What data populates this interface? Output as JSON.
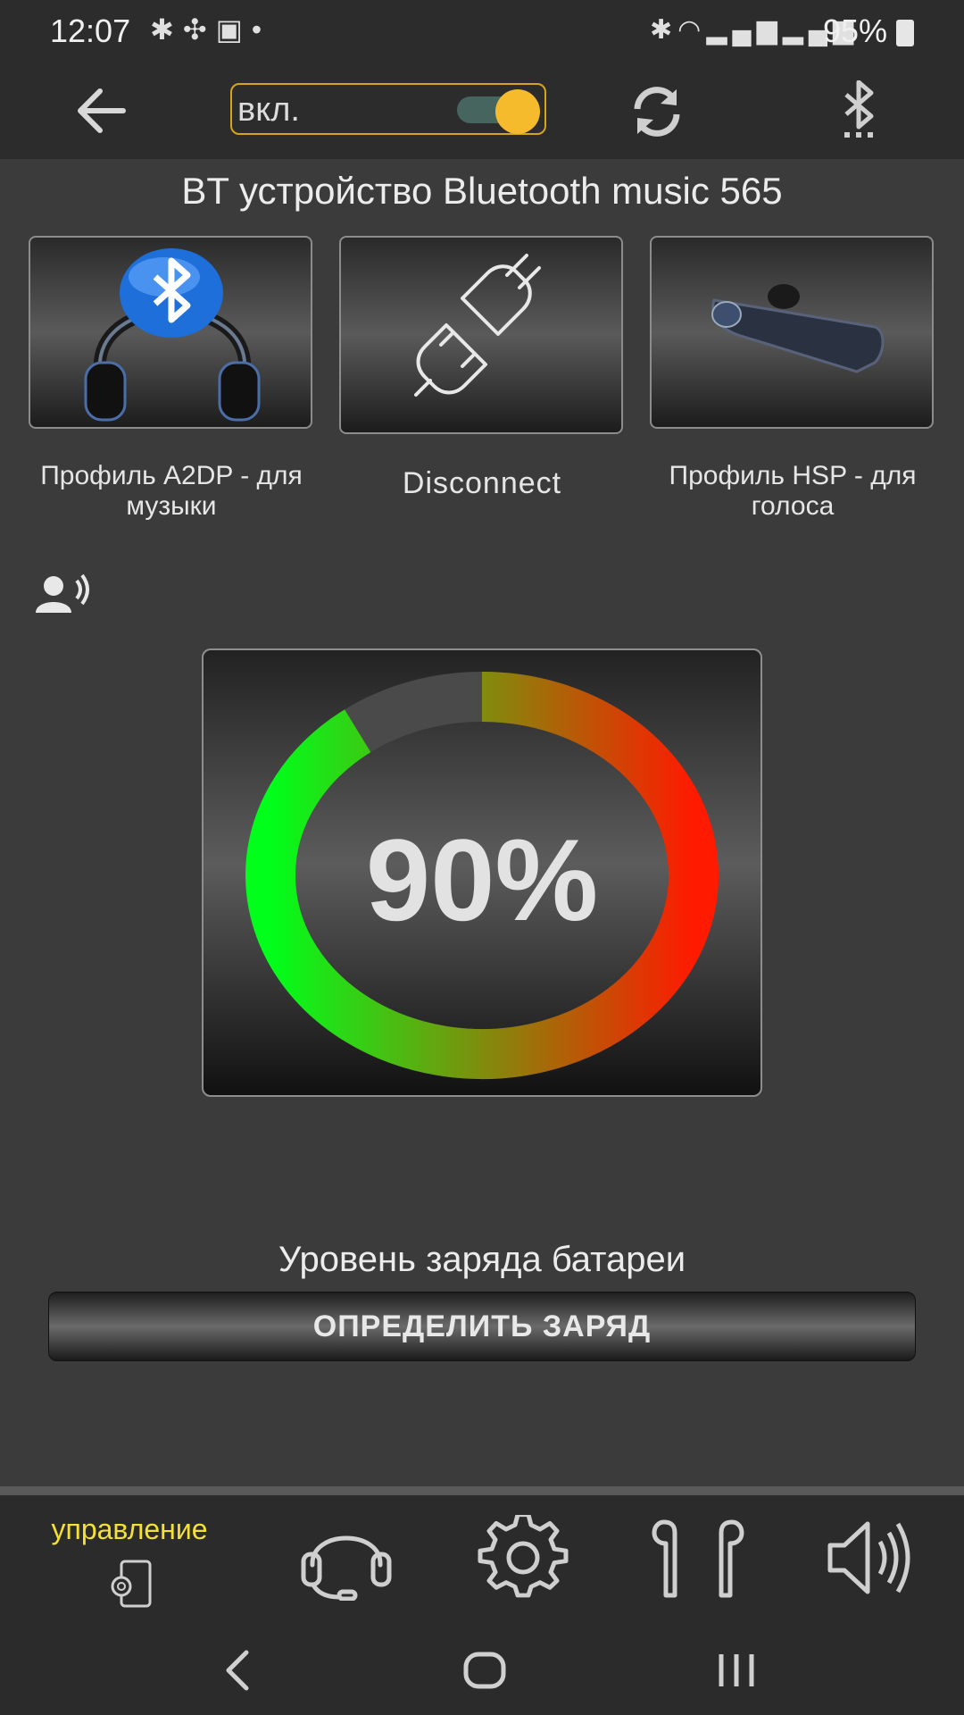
{
  "status_bar": {
    "time": "12:07",
    "left_icons": [
      "bluetooth-headset-icon",
      "link-icon",
      "image-icon",
      "dot-icon"
    ],
    "right_icons": [
      "bluetooth-icon",
      "wifi-icon",
      "signal-icon",
      "signal-icon"
    ],
    "battery_percent": "95%"
  },
  "toolbar": {
    "power_label": "вкл.",
    "power_on": true,
    "accent_color": "#f6bb2d"
  },
  "device_title": "BT устройство Bluetooth music 565",
  "tiles": [
    {
      "label": "Профиль A2DP - для музыки",
      "icon": "headphones-bluetooth-icon"
    },
    {
      "label": "Disconnect",
      "icon": "plug-disconnect-icon"
    },
    {
      "label": "Профиль HSP - для голоса",
      "icon": "headset-earpiece-icon"
    }
  ],
  "gauge": {
    "value_text": "90%",
    "percent": 90,
    "color_start": "#ff1a00",
    "color_end": "#00ff1a"
  },
  "battery_caption": "Уровень заряда батареи",
  "detect_button_label": "ОПРЕДЕЛИТЬ ЗАРЯД",
  "bottom_nav": {
    "active_label": "управление",
    "items": [
      "control-icon",
      "headset-icon",
      "settings-icon",
      "earbuds-icon",
      "speaker-icon"
    ],
    "active_color": "#f4e133"
  }
}
